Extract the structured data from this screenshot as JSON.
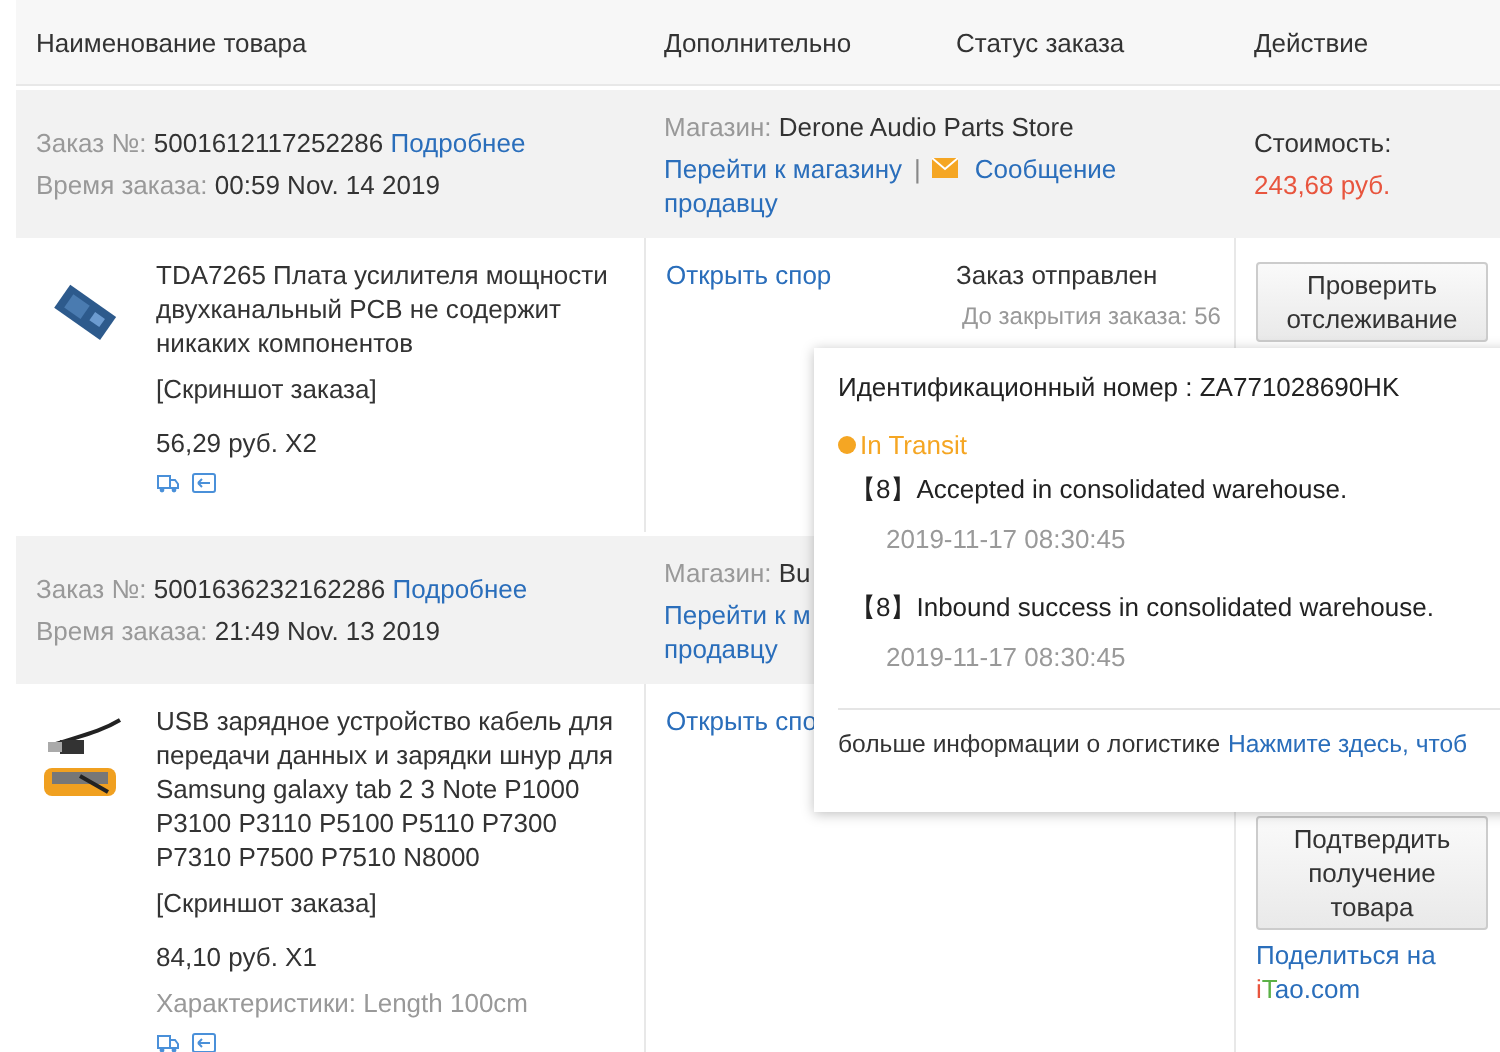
{
  "columns": [
    "Наименование товара",
    "Дополнительно",
    "Статус заказа",
    "Действие"
  ],
  "orders": [
    {
      "number_label": "Заказ №:",
      "number": "5001612117252286",
      "details_link": "Подробнее",
      "time_label": "Время заказа:",
      "time": "00:59 Nov. 14 2019",
      "shop_label": "Магазин:",
      "shop": "Derone Audio Parts Store",
      "shop_link": "Перейти к магазину",
      "separator": "|",
      "message_lines": [
        "Сообщение",
        "продавцу"
      ],
      "cost_label": "Стоимость:",
      "cost": "243,68 руб.",
      "item": {
        "title": "TDA7265 Плата усилителя мощности двухканальный PCB не содержит никаких компонентов",
        "screenshot": "[Скриншот заказа]",
        "price": "56,29 руб. X2",
        "dispute": "Открыть спор",
        "status": "Заказ отправлен",
        "countdown": "До закрытия заказа: 56",
        "buttons": [
          "Проверить отслеживание"
        ]
      }
    },
    {
      "number_label": "Заказ №:",
      "number": "5001636232162286",
      "details_link": "Подробнее",
      "time_label": "Время заказа:",
      "time": "21:49 Nov. 13 2019",
      "shop_label": "Магазин:",
      "shop": "Bu",
      "shop_link": "Перейти к м",
      "message_lines": [
        "продавцу"
      ],
      "item": {
        "title": "USB зарядное устройство кабель для передачи данных и зарядки шнур для Samsung galaxy tab 2 3 Note P1000 P3100 P3110 P5100 P5110 P7300 P7310 P7500 P7510 N8000",
        "screenshot": "[Скриншот заказа]",
        "price": "84,10 руб. X1",
        "specs": "Характеристики: Length 100cm",
        "dispute": "Открыть спо",
        "buttons": [
          "Подтвердить получение товара"
        ],
        "share": "Поделиться на",
        "share_parts": [
          {
            "text": "i",
            "color": "#e8553e"
          },
          {
            "text": "T",
            "color": "#5bb146"
          },
          {
            "text": "ao.com",
            "color": "#2a6ebb"
          }
        ]
      }
    }
  ],
  "tracking": {
    "id_text": "Идентификационный номер : ZA771028690HK",
    "status": "In Transit",
    "events": [
      {
        "code": "【8】",
        "text": "Accepted in consolidated warehouse.",
        "time": "2019-11-17 08:30:45"
      },
      {
        "code": "【8】",
        "text": "Inbound success in consolidated warehouse.",
        "time": "2019-11-17 08:30:45"
      }
    ],
    "footer": "больше информации о логистике",
    "footer_link": "Нажмите здесь, чтоб"
  }
}
